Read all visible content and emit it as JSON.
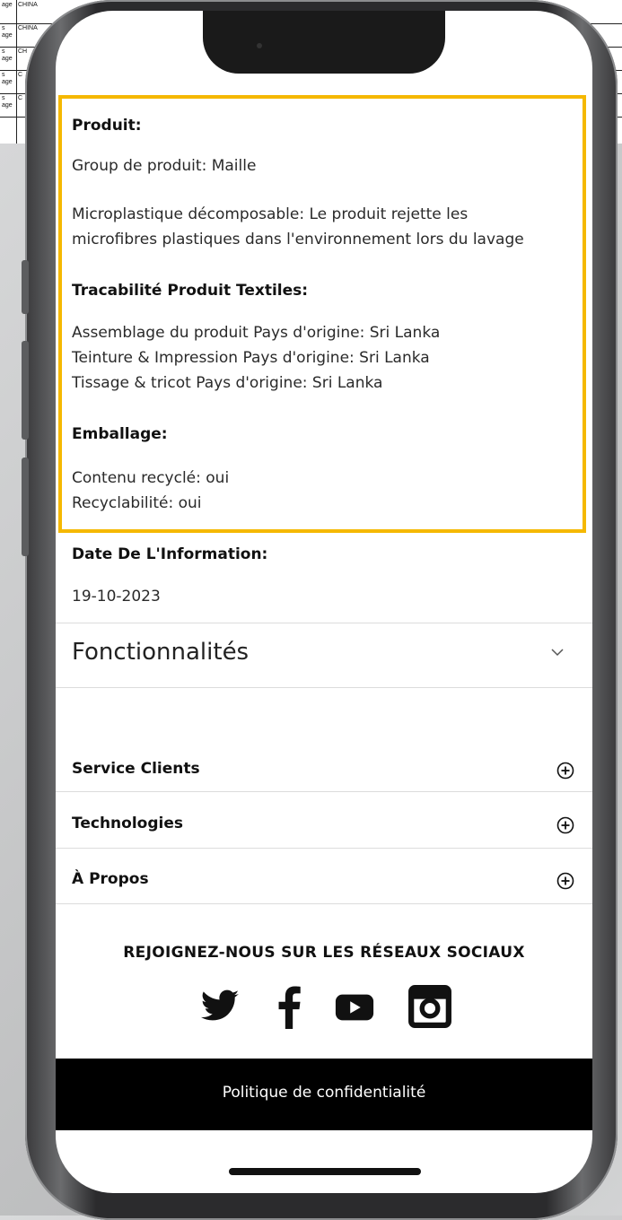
{
  "background_sheet": {
    "rows": [
      {
        "c1": "age",
        "c2": "CHINA"
      },
      {
        "c1": "s\nage",
        "c2": "CHINA"
      },
      {
        "c1": "s\nage",
        "c2": "CH"
      },
      {
        "c1": "s\nage",
        "c2": "C"
      },
      {
        "c1": "s\nage",
        "c2": "C"
      }
    ]
  },
  "product": {
    "heading": "Produit:",
    "group": "Group de produit: Maille",
    "microplastic_line1": "Microplastique décomposable: Le produit rejette les",
    "microplastic_line2": "microfibres plastiques dans l'environnement lors du lavage"
  },
  "traceability": {
    "heading": "Tracabilité Produit Textiles:",
    "lines": [
      "Assemblage du produit Pays d'origine: Sri Lanka",
      "Teinture & Impression Pays d'origine: Sri Lanka",
      "Tissage & tricot Pays d'origine: Sri Lanka"
    ]
  },
  "packaging": {
    "heading": "Emballage:",
    "lines": [
      "Contenu recyclé: oui",
      "Recyclabilité: oui"
    ]
  },
  "info_date": {
    "heading": "Date De L'Information:",
    "value": "19-10-2023"
  },
  "features": {
    "title": "Fonctionnalités",
    "icon": "chevron-down-icon"
  },
  "accordion": [
    {
      "label": "Service Clients",
      "icon": "plus-circle-icon"
    },
    {
      "label": "Technologies",
      "icon": "plus-circle-icon"
    },
    {
      "label": "À Propos",
      "icon": "plus-circle-icon"
    }
  ],
  "social": {
    "title": "REJOIGNEZ-NOUS SUR LES RÉSEAUX SOCIAUX",
    "icons": [
      "twitter-icon",
      "facebook-icon",
      "youtube-icon",
      "instagram-icon"
    ]
  },
  "footer": {
    "privacy_link": "Politique de confidentialité"
  },
  "colors": {
    "highlight": "#f5b800",
    "footer_bg": "#000000",
    "text": "#222222"
  }
}
